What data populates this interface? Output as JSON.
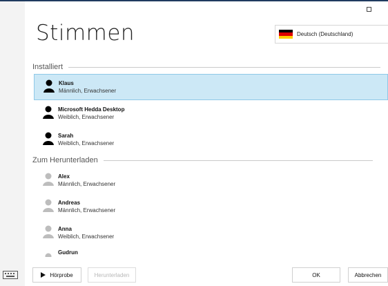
{
  "page": {
    "title": "Stimmen"
  },
  "language": {
    "value": "Deutsch (Deutschland)"
  },
  "sections": {
    "installed": "Installiert",
    "download": "Zum Herunterladen"
  },
  "installed": [
    {
      "name": "Klaus",
      "desc": "Männlich, Erwachsener"
    },
    {
      "name": "Microsoft Hedda Desktop",
      "desc": "Weiblich, Erwachsener"
    },
    {
      "name": "Sarah",
      "desc": "Weiblich, Erwachsener"
    }
  ],
  "download": [
    {
      "name": "Alex",
      "desc": "Männlich, Erwachsener"
    },
    {
      "name": "Andreas",
      "desc": "Männlich, Erwachsener"
    },
    {
      "name": "Anna",
      "desc": "Weiblich, Erwachsener"
    },
    {
      "name": "Gudrun",
      "desc": ""
    }
  ],
  "buttons": {
    "preview": "Hörprobe",
    "download": "Herunterladen",
    "ok": "OK",
    "cancel": "Abbrechen"
  }
}
